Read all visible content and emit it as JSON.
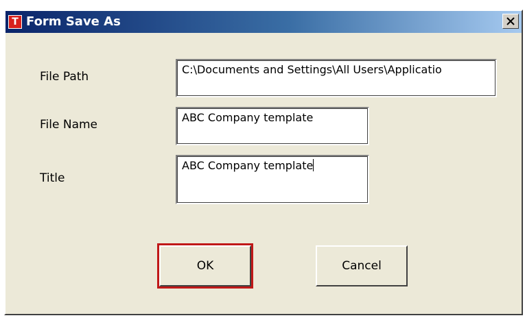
{
  "window": {
    "title": "Form Save As",
    "icon_letter": "T",
    "icon_color": "#d8201c"
  },
  "form": {
    "file_path_label": "File Path",
    "file_path_value": "C:\\Documents and Settings\\All Users\\Applicatio",
    "file_name_label": "File Name",
    "file_name_value": "ABC Company template",
    "title_label": "Title",
    "title_value": "ABC Company template"
  },
  "buttons": {
    "ok_label": "OK",
    "cancel_label": "Cancel"
  }
}
